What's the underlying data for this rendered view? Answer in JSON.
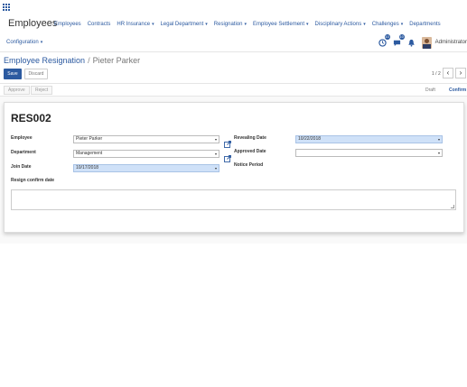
{
  "navbar": {
    "brand": "Employees",
    "menu": [
      {
        "label": "Employees",
        "has_dropdown": false
      },
      {
        "label": "Contracts",
        "has_dropdown": false
      },
      {
        "label": "HR Insurance",
        "has_dropdown": true
      },
      {
        "label": "Legal Department",
        "has_dropdown": true
      },
      {
        "label": "Resignation",
        "has_dropdown": true
      },
      {
        "label": "Employee Settlement",
        "has_dropdown": true
      },
      {
        "label": "Disciplinary Actions",
        "has_dropdown": true
      },
      {
        "label": "Challenges",
        "has_dropdown": true
      },
      {
        "label": "Departments",
        "has_dropdown": false
      }
    ],
    "configuration_label": "Configuration",
    "caret": "▾",
    "activity_badge": "10",
    "messages_badge": "10",
    "user_name": "Administrator"
  },
  "breadcrumb": {
    "parent": "Employee Resignation",
    "separator": "/",
    "current": "Pieter Parker"
  },
  "buttons": {
    "save": "Save",
    "discard": "Discard"
  },
  "pager": {
    "value": "1 / 2",
    "prev": "‹",
    "next": "›"
  },
  "statusbar": {
    "approve": "Approve",
    "reject": "Reject",
    "stages": [
      "Draft",
      "Confirm"
    ],
    "active_stage": "Confirm"
  },
  "form": {
    "record_name": "RES002",
    "employee_label": "Employee",
    "employee_value": "Pieter Parker",
    "department_label": "Department",
    "department_value": "Management",
    "join_date_label": "Join Date",
    "join_date_value": "10/17/2018",
    "resign_confirm_label": "Resign confirm date",
    "revealing_date_label": "Revealing Date",
    "revealing_date_value": "10/22/2018",
    "approved_date_label": "Approved Date",
    "approved_date_value": "",
    "notice_period_label": "Notice Period"
  },
  "colors": {
    "accent": "#2c5aa0",
    "required_field": "#cfe1f8"
  }
}
